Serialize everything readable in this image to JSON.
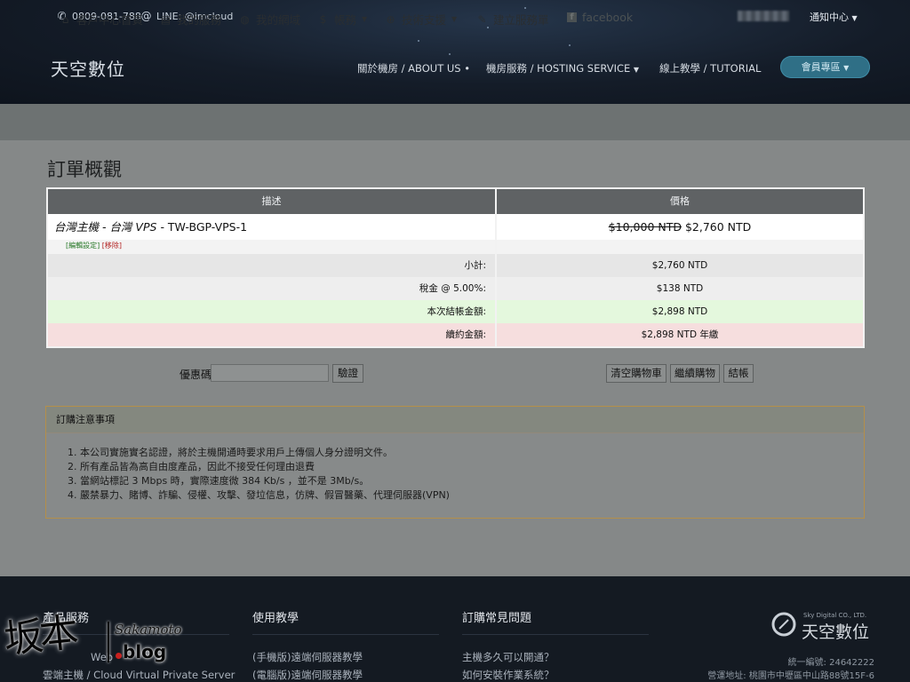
{
  "header": {
    "phone": "0809-081-788",
    "line": "LINE: @imcloud",
    "notify": "通知中心",
    "brand": "天空數位",
    "nav": [
      {
        "label": "關於機房 / ABOUT US"
      },
      {
        "label": "機房服務 / HOSTING SERVICE"
      },
      {
        "label": "線上教學 / TUTORIAL"
      }
    ],
    "member_button": "會員專區"
  },
  "subnav": {
    "items": [
      {
        "icon": "home-icon",
        "label": "客戶中心首頁"
      },
      {
        "icon": "server-icon",
        "label": "我的服務"
      },
      {
        "icon": "globe-icon",
        "label": "我的網域"
      },
      {
        "icon": "dollar-icon",
        "label": "帳務"
      },
      {
        "icon": "support-icon",
        "label": "技術支援"
      },
      {
        "icon": "edit-icon",
        "label": "建立服務單"
      },
      {
        "icon": "facebook-icon",
        "label": "facebook"
      }
    ]
  },
  "page_title": "訂單概觀",
  "cart": {
    "headers": {
      "description": "描述",
      "price": "價格"
    },
    "product": {
      "group": "台灣主機 - 台灣 VPS",
      "name": " - TW-BGP-VPS-1",
      "original_price": "$10,000 NTD",
      "price": " $2,760 NTD",
      "edit_link": "[編輯設定]",
      "remove_link": "[移除]"
    },
    "rows": [
      {
        "label": "小計:",
        "value": "$2,760 NTD"
      },
      {
        "label": "稅金 @ 5.00%:",
        "value": "$138 NTD"
      },
      {
        "label": "本次結帳金額:",
        "value": "$2,898 NTD"
      },
      {
        "label": "續約金額:",
        "value": "$2,898 NTD 年繳"
      }
    ]
  },
  "promo": {
    "label": "優惠碼",
    "input_value": "",
    "validate_button": "驗證"
  },
  "actions": {
    "empty_cart": "清空購物車",
    "continue_shopping": "繼續購物",
    "checkout": "結帳"
  },
  "notice": {
    "title": "訂購注意事項",
    "items": [
      "本公司實施實名認證，將於主機開通時要求用戶上傳個人身分證明文件。",
      "所有產品皆為高自由度產品，因此不接受任何理由退費",
      "當網站標記 3 Mbps 時，實際速度微 384 Kb/s ，並不是 3Mb/s。",
      "嚴禁暴力、賭博、詐騙、侵權、攻擊、發垃信息，仿牌、假冒醫藥、代理伺服器(VPN)"
    ]
  },
  "footer": {
    "columns": [
      {
        "title": "產品服務",
        "links": [
          "Web",
          "雲端主機 / Cloud Virtual Private Server"
        ]
      },
      {
        "title": "使用教學",
        "links": [
          "(手機版)遠端伺服器教學",
          "(電腦版)遠端伺服器教學"
        ]
      },
      {
        "title": "訂購常見問題",
        "links": [
          "主機多久可以開通？",
          "如何安裝作業系統？"
        ]
      }
    ],
    "logo_small": "Sky Digital CO., LTD.",
    "logo_name": "天空數位",
    "tax_id": "統一編號: 24642222",
    "address": "營運地址: 桃園市中壢區中山路88號15F-6"
  },
  "watermark": {
    "cn": "坂本",
    "en": "Sakamoto",
    "blog": "blog"
  },
  "colors": {
    "accent": "#2f6f86",
    "header_bg": "#141c28",
    "due_today_bg": "#e4f8dd",
    "recurring_bg": "#f6dede"
  }
}
